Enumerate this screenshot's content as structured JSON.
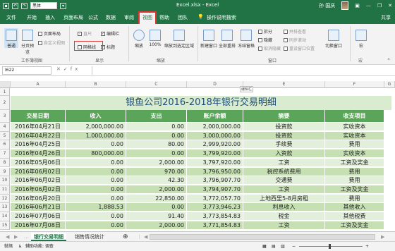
{
  "titlebar": {
    "font_name": "黑体",
    "title": "Excel.xlsx - Excel",
    "user": "孙 国庆"
  },
  "tabs": [
    "文件",
    "开始",
    "插入",
    "页面布局",
    "公式",
    "数据",
    "审阅",
    "视图",
    "帮助",
    "团队",
    "操作说明搜索"
  ],
  "share": "共享",
  "ribbon": {
    "view_normal": "普通",
    "view_pagebreak": "分页预览",
    "page_layout": "页面布局",
    "custom_views": "自定义视图",
    "group_workbook_views": "工作簿视图",
    "ruler": "直尺",
    "gridlines": "网格线",
    "formula_bar": "编辑栏",
    "headings": "标题",
    "group_show": "显示",
    "zoom": "缩放",
    "zoom100": "100%",
    "zoom_selection": "缩放到选定区域",
    "group_zoom": "缩放",
    "new_window": "新建窗口",
    "arrange_all": "全部重排",
    "freeze_panes": "冻结窗格",
    "split": "拆分",
    "hide": "隐藏",
    "unhide": "取消隐藏",
    "side_by_side": "并排查看",
    "sync_scroll": "同步滚动",
    "reset_pos": "重设窗口位置",
    "switch_windows": "切换窗口",
    "group_window": "窗口",
    "macros": "宏",
    "group_macros": "宏"
  },
  "formula_bar": {
    "name_box": "I622",
    "fx": "fx"
  },
  "columns": [
    "A",
    "B",
    "C",
    "D",
    "E",
    "F",
    "G"
  ],
  "sheet": {
    "title": "银鱼公司2016-2018年银行交易明细",
    "headers": [
      "交易日期",
      "收入",
      "支出",
      "账户余额",
      "摘要",
      "收支项目"
    ],
    "rows": [
      [
        "2016年04月21日",
        "2,000,000.00",
        "0.00",
        "2,000,000.00",
        "投资款",
        "实收资本"
      ],
      [
        "2016年04月22日",
        "1,000,000.00",
        "0.00",
        "3,000,000.00",
        "投资款",
        "实收资本"
      ],
      [
        "2016年04月25日",
        "0.00",
        "80.00",
        "2,999,920.00",
        "手续费",
        "费用"
      ],
      [
        "2016年04月26日",
        "800,000.00",
        "0.00",
        "3,799,920.00",
        "入资款",
        "实收资本"
      ],
      [
        "2016年05月06日",
        "0.00",
        "2,000.00",
        "3,797,920.00",
        "工资",
        "工资及奖金"
      ],
      [
        "2016年06月02日",
        "0.00",
        "970.00",
        "3,796,950.00",
        "税控系统费用",
        "费用"
      ],
      [
        "2016年06月02日",
        "0.00",
        "42.30",
        "3,796,907.70",
        "交通费",
        "费用"
      ],
      [
        "2016年06月02日",
        "0.00",
        "2,000.00",
        "3,794,907.70",
        "工资",
        "工资及奖金"
      ],
      [
        "2016年06月20日",
        "0.00",
        "22,850.00",
        "3,772,057.70",
        "上地西里5-8月房租",
        "费用"
      ],
      [
        "2016年06月21日",
        "1,888.53",
        "0.00",
        "3,773,946.23",
        "利息收入",
        "其他收入"
      ],
      [
        "2016年07月06日",
        "0.00",
        "91.40",
        "3,773,854.83",
        "税金",
        "其他税费"
      ],
      [
        "2016年07月08日",
        "0.00",
        "2,000.00",
        "3,771,854.83",
        "工资",
        "工资及奖金"
      ]
    ],
    "row_numbers": [
      "1",
      "2",
      "3",
      "4",
      "5",
      "6",
      "7",
      "8",
      "9",
      "10",
      "11",
      "12",
      "13",
      "14",
      "15"
    ]
  },
  "sheet_tabs": [
    "银行交易明细",
    "销售情况统计"
  ],
  "status": {
    "ready": "就绪",
    "accessibility": "辅助功能: 调查"
  },
  "hint": "编辑栏"
}
